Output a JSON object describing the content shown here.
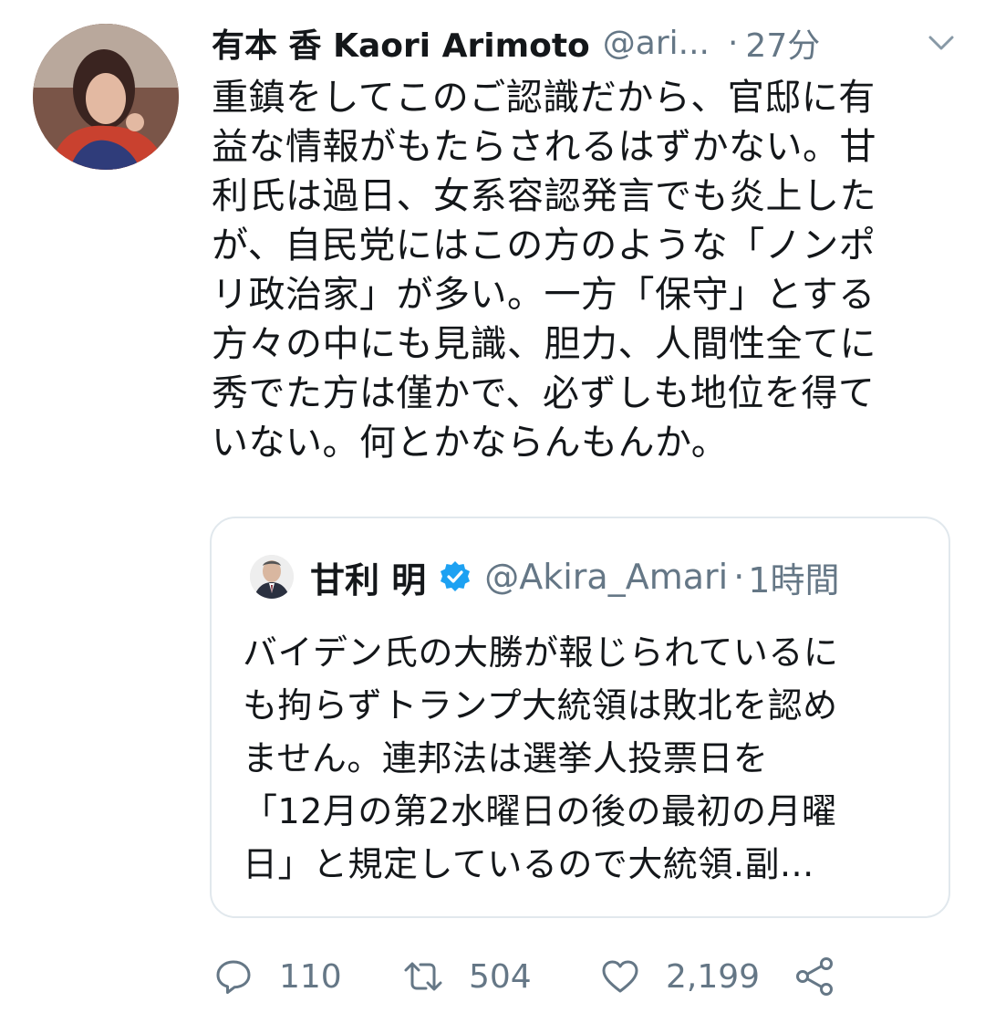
{
  "tweet": {
    "author_name": "有本 香 Kaori Arimoto",
    "author_handle": "@ari...",
    "time_separator": "·",
    "time": "27分",
    "text_lines": [
      "重鎮をしてこのご認識だから、官邸に有",
      "益な情報がもたらされるはずかない。甘",
      "利氏は過日、女系容認発言でも炎上した",
      "が、自民党にはこの方のような「ノンポ",
      "リ政治家」が多い。一方「保守」とする",
      "方々の中にも見識、胆力、人間性全てに",
      "秀でた方は僅かで、必ずしも地位を得て",
      "いない。何とかならんもんか。"
    ],
    "icons": {
      "avatar": "avatar-photo-icon",
      "menu": "chevron-down-icon"
    }
  },
  "quoted_tweet": {
    "author_name": "甘利 明",
    "author_handle": "@Akira_Amari",
    "time_separator": "·",
    "time": "1時間",
    "text_lines": [
      "バイデン氏の大勝が報じられているに",
      "も拘らずトランプ大統領は敗北を認め",
      "ません。連邦法は選挙人投票日を",
      "「12月の第2水曜日の後の最初の月曜",
      "日」と規定しているので大統領.副..."
    ],
    "icons": {
      "avatar": "avatar-photo-icon",
      "verified": "verified-badge-icon"
    }
  },
  "actions": {
    "reply_count": "110",
    "retweet_count": "504",
    "like_count": "2,199",
    "icons": {
      "reply": "reply-icon",
      "retweet": "retweet-icon",
      "like": "heart-icon",
      "share": "share-icon"
    }
  },
  "colors": {
    "text": "#14171a",
    "secondary": "#657786",
    "border": "#e1e8ed",
    "verified": "#1da1f2"
  }
}
